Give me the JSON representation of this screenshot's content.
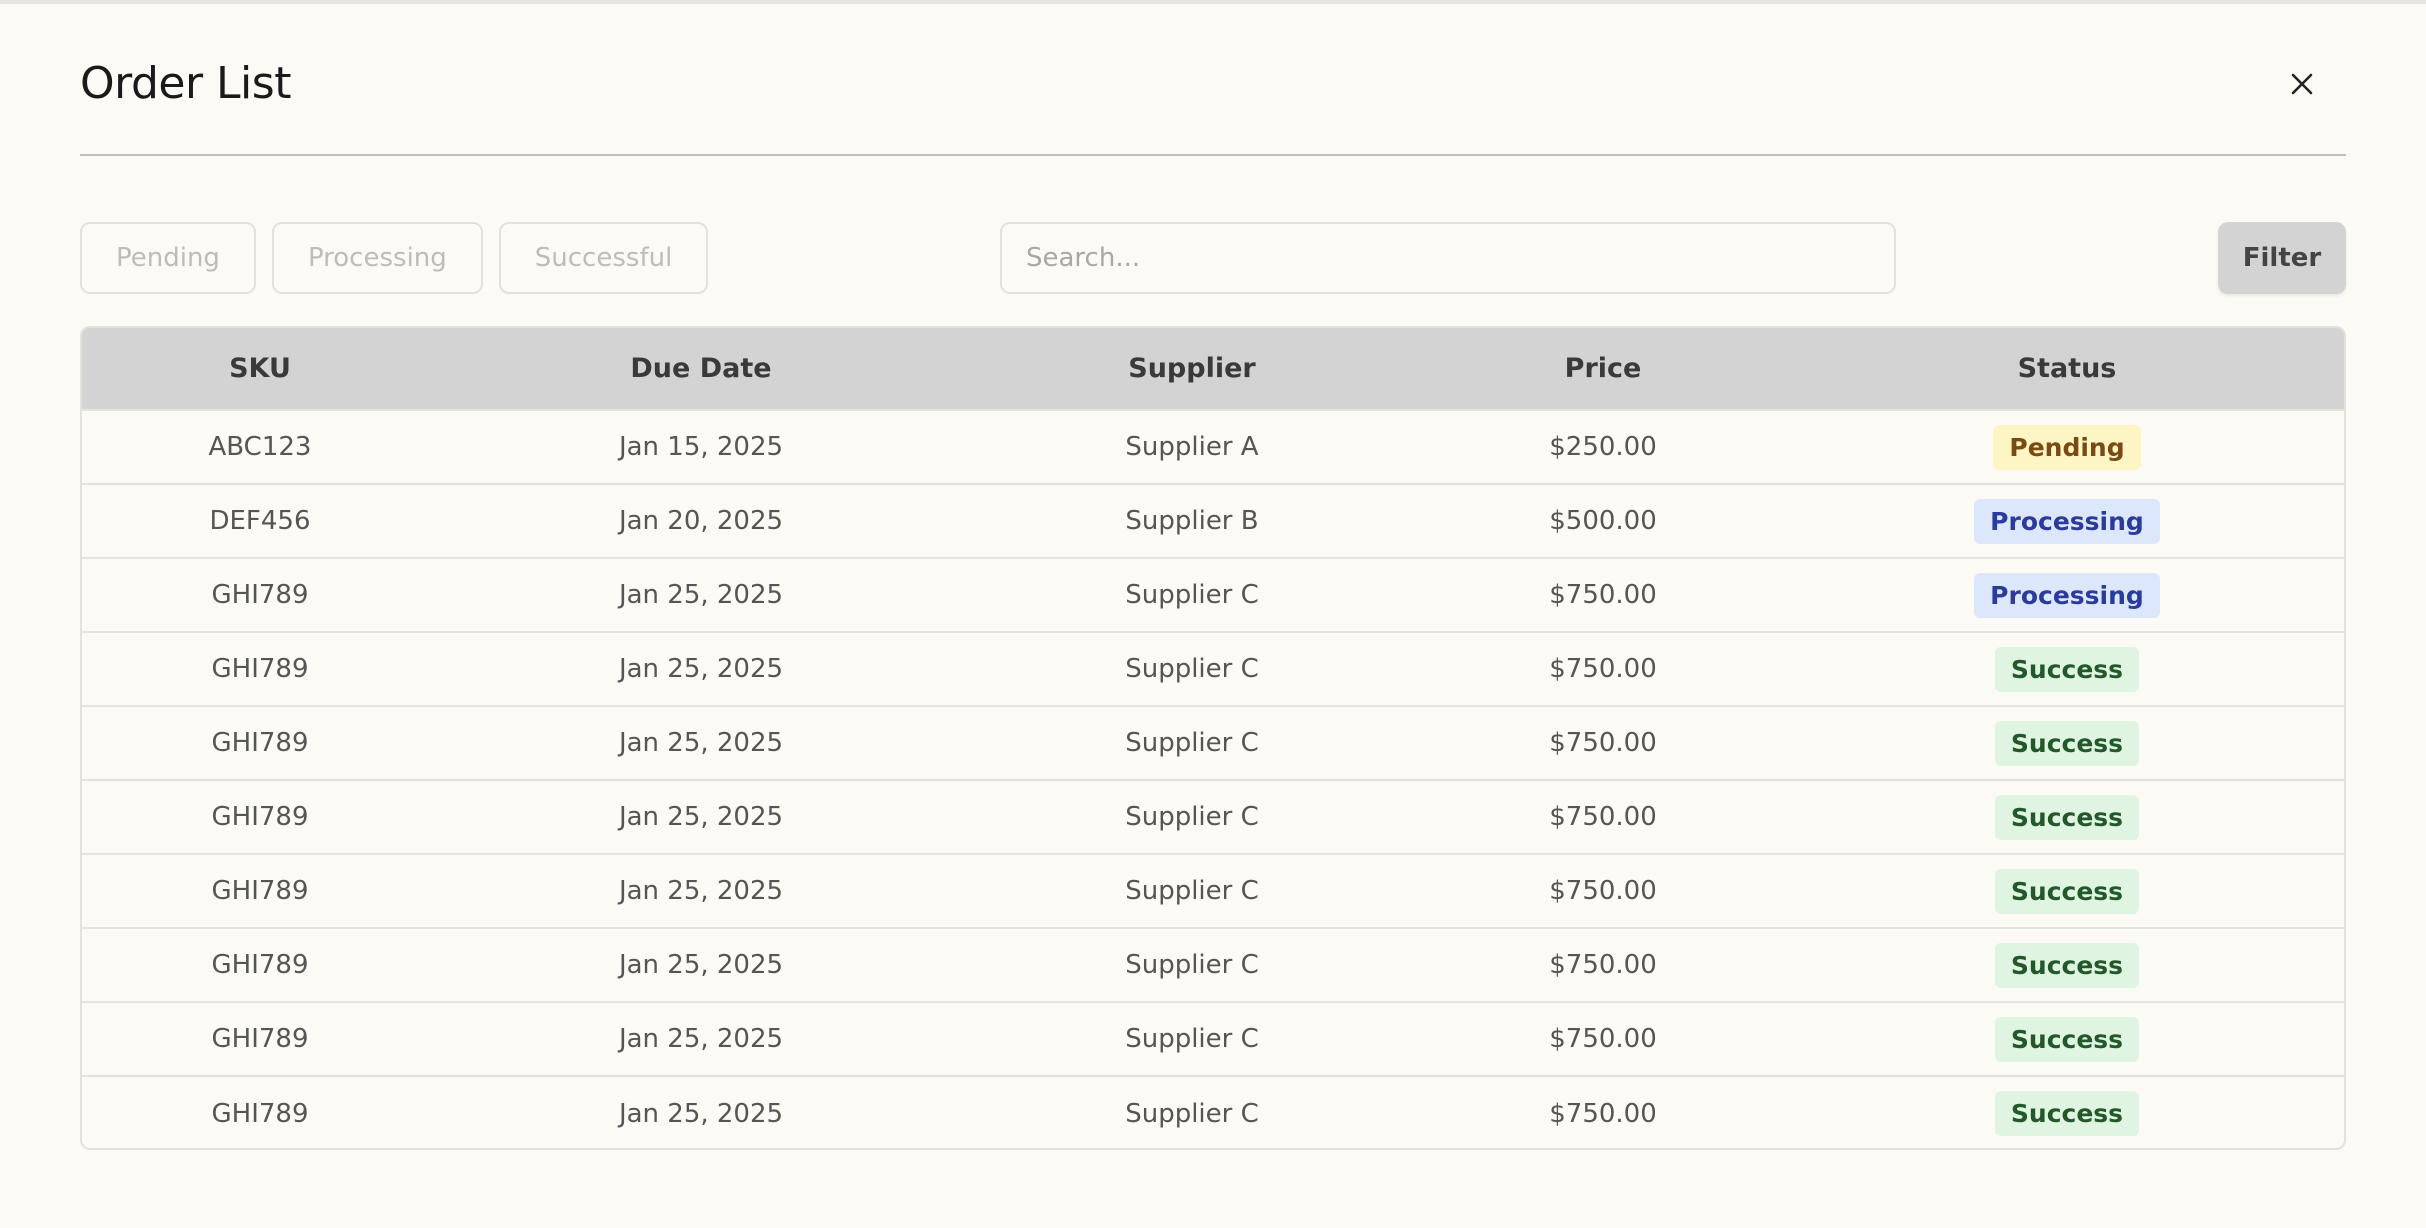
{
  "header": {
    "title": "Order List",
    "close_icon": "close-icon"
  },
  "toolbar": {
    "tabs": [
      {
        "label": "Pending"
      },
      {
        "label": "Processing"
      },
      {
        "label": "Successful"
      }
    ],
    "search_placeholder": "Search...",
    "filter_label": "Filter"
  },
  "table": {
    "columns": [
      "SKU",
      "Due Date",
      "Supplier",
      "Price",
      "Status"
    ],
    "rows": [
      {
        "sku": "ABC123",
        "due_date": "Jan 15, 2025",
        "supplier": "Supplier A",
        "price": "$250.00",
        "status": "Pending",
        "status_kind": "pending"
      },
      {
        "sku": "DEF456",
        "due_date": "Jan 20, 2025",
        "supplier": "Supplier B",
        "price": "$500.00",
        "status": "Processing",
        "status_kind": "processing"
      },
      {
        "sku": "GHI789",
        "due_date": "Jan 25, 2025",
        "supplier": "Supplier C",
        "price": "$750.00",
        "status": "Processing",
        "status_kind": "processing"
      },
      {
        "sku": "GHI789",
        "due_date": "Jan 25, 2025",
        "supplier": "Supplier C",
        "price": "$750.00",
        "status": "Success",
        "status_kind": "success"
      },
      {
        "sku": "GHI789",
        "due_date": "Jan 25, 2025",
        "supplier": "Supplier C",
        "price": "$750.00",
        "status": "Success",
        "status_kind": "success"
      },
      {
        "sku": "GHI789",
        "due_date": "Jan 25, 2025",
        "supplier": "Supplier C",
        "price": "$750.00",
        "status": "Success",
        "status_kind": "success"
      },
      {
        "sku": "GHI789",
        "due_date": "Jan 25, 2025",
        "supplier": "Supplier C",
        "price": "$750.00",
        "status": "Success",
        "status_kind": "success"
      },
      {
        "sku": "GHI789",
        "due_date": "Jan 25, 2025",
        "supplier": "Supplier C",
        "price": "$750.00",
        "status": "Success",
        "status_kind": "success"
      },
      {
        "sku": "GHI789",
        "due_date": "Jan 25, 2025",
        "supplier": "Supplier C",
        "price": "$750.00",
        "status": "Success",
        "status_kind": "success"
      },
      {
        "sku": "GHI789",
        "due_date": "Jan 25, 2025",
        "supplier": "Supplier C",
        "price": "$750.00",
        "status": "Success",
        "status_kind": "success"
      }
    ]
  },
  "colors": {
    "background": "#fcfaf4",
    "header_bg": "#d3d3d3",
    "pending_bg": "#fdf5c4",
    "pending_text": "#7a4a12",
    "processing_bg": "#dde7fb",
    "processing_text": "#2a3b9c",
    "success_bg": "#dff5e1",
    "success_text": "#23582a"
  }
}
